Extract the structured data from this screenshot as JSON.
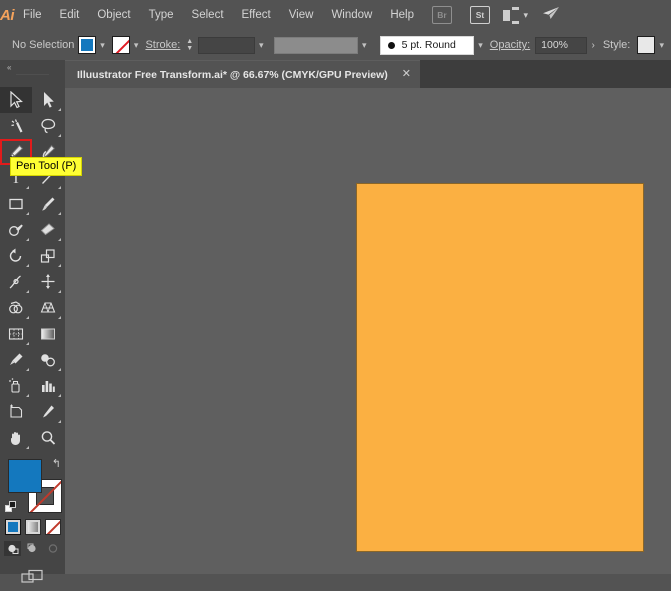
{
  "app": {
    "name": "Adobe Illustrator",
    "logo_text": "Ai"
  },
  "menubar": {
    "items": [
      {
        "label": "File"
      },
      {
        "label": "Edit"
      },
      {
        "label": "Object"
      },
      {
        "label": "Type"
      },
      {
        "label": "Select"
      },
      {
        "label": "Effect"
      },
      {
        "label": "View"
      },
      {
        "label": "Window"
      },
      {
        "label": "Help"
      }
    ],
    "right_icons": [
      {
        "name": "bridge-icon",
        "label": "Br"
      },
      {
        "name": "stock-icon",
        "label": "St"
      }
    ],
    "arrange_documents_label": "",
    "share_label": ""
  },
  "controlbar": {
    "selection_status": "No Selection",
    "fill_color": "#1478be",
    "stroke_color": "none",
    "stroke_label": "Stroke:",
    "stroke_weight_value": "",
    "stroke_profile_value": "",
    "brush_definition": "5 pt. Round",
    "opacity_label": "Opacity:",
    "opacity_value": "100%",
    "opacity_arrow": "›",
    "style_label": "Style:",
    "style_swatch_color": "#e8e8e8",
    "chevron": "⌄"
  },
  "tabbar": {
    "document_title": "Illuustrator Free Transform.ai* @ 66.67% (CMYK/GPU Preview)",
    "close_glyph": "✕"
  },
  "toolpanel": {
    "collapse_glyph": "«",
    "tooltip_text": "Pen Tool (P)",
    "highlighted_tool": "pen-tool",
    "active_tool": "selection-tool",
    "tools": [
      {
        "name": "selection-tool",
        "label": "Selection Tool (V)"
      },
      {
        "name": "direct-selection-tool",
        "label": "Direct Selection Tool (A)"
      },
      {
        "name": "magic-wand-tool",
        "label": "Magic Wand Tool (Y)"
      },
      {
        "name": "lasso-tool",
        "label": "Lasso Tool (Q)"
      },
      {
        "name": "pen-tool",
        "label": "Pen Tool (P)"
      },
      {
        "name": "curvature-tool",
        "label": "Curvature Tool (Shift+~)"
      },
      {
        "name": "type-tool",
        "label": "Type Tool (T)"
      },
      {
        "name": "line-segment-tool",
        "label": "Line Segment Tool (\\)"
      },
      {
        "name": "rectangle-tool",
        "label": "Rectangle Tool (M)"
      },
      {
        "name": "paintbrush-tool",
        "label": "Paintbrush Tool (B)"
      },
      {
        "name": "shaper-tool",
        "label": "Shaper Tool (Shift+N)"
      },
      {
        "name": "eraser-tool",
        "label": "Eraser Tool (Shift+E)"
      },
      {
        "name": "rotate-tool",
        "label": "Rotate Tool (R)"
      },
      {
        "name": "scale-tool",
        "label": "Scale Tool (S)"
      },
      {
        "name": "width-tool",
        "label": "Width Tool (Shift+W)"
      },
      {
        "name": "free-transform-tool",
        "label": "Free Transform Tool (E)"
      },
      {
        "name": "shape-builder-tool",
        "label": "Shape Builder Tool (Shift+M)"
      },
      {
        "name": "perspective-grid-tool",
        "label": "Perspective Grid Tool (Shift+P)"
      },
      {
        "name": "mesh-tool",
        "label": "Mesh Tool (U)"
      },
      {
        "name": "gradient-tool",
        "label": "Gradient Tool (G)"
      },
      {
        "name": "eyedropper-tool",
        "label": "Eyedropper Tool (I)"
      },
      {
        "name": "blend-tool",
        "label": "Blend Tool (W)"
      },
      {
        "name": "symbol-sprayer-tool",
        "label": "Symbol Sprayer Tool (Shift+S)"
      },
      {
        "name": "column-graph-tool",
        "label": "Column Graph Tool (J)"
      },
      {
        "name": "artboard-tool",
        "label": "Artboard Tool (Shift+O)"
      },
      {
        "name": "slice-tool",
        "label": "Slice Tool (Shift+K)"
      },
      {
        "name": "hand-tool",
        "label": "Hand Tool (H)"
      },
      {
        "name": "zoom-tool",
        "label": "Zoom Tool (Z)"
      }
    ],
    "fill_stroke": {
      "fill_color": "#1478be",
      "stroke_color": "none",
      "swap_glyph": "↰"
    },
    "color_modes": [
      {
        "name": "color-mode-button",
        "label": "Color"
      },
      {
        "name": "gradient-mode-button",
        "label": "Gradient"
      },
      {
        "name": "none-mode-button",
        "label": "None"
      }
    ],
    "draw_modes": [
      {
        "name": "draw-normal-button",
        "label": "Draw Normal",
        "state": "on"
      },
      {
        "name": "draw-behind-button",
        "label": "Draw Behind",
        "state": "off"
      },
      {
        "name": "draw-inside-button",
        "label": "Draw Inside",
        "state": "disabled"
      }
    ],
    "screen_mode_label": "Change Screen Mode"
  },
  "canvas": {
    "background_color": "#5f5f5f",
    "artboard": {
      "fill_color": "#fbb042",
      "name": "orange-artboard-rectangle"
    },
    "shape": {
      "fill_color": "#1478be",
      "name": "blue-rectangle"
    }
  }
}
